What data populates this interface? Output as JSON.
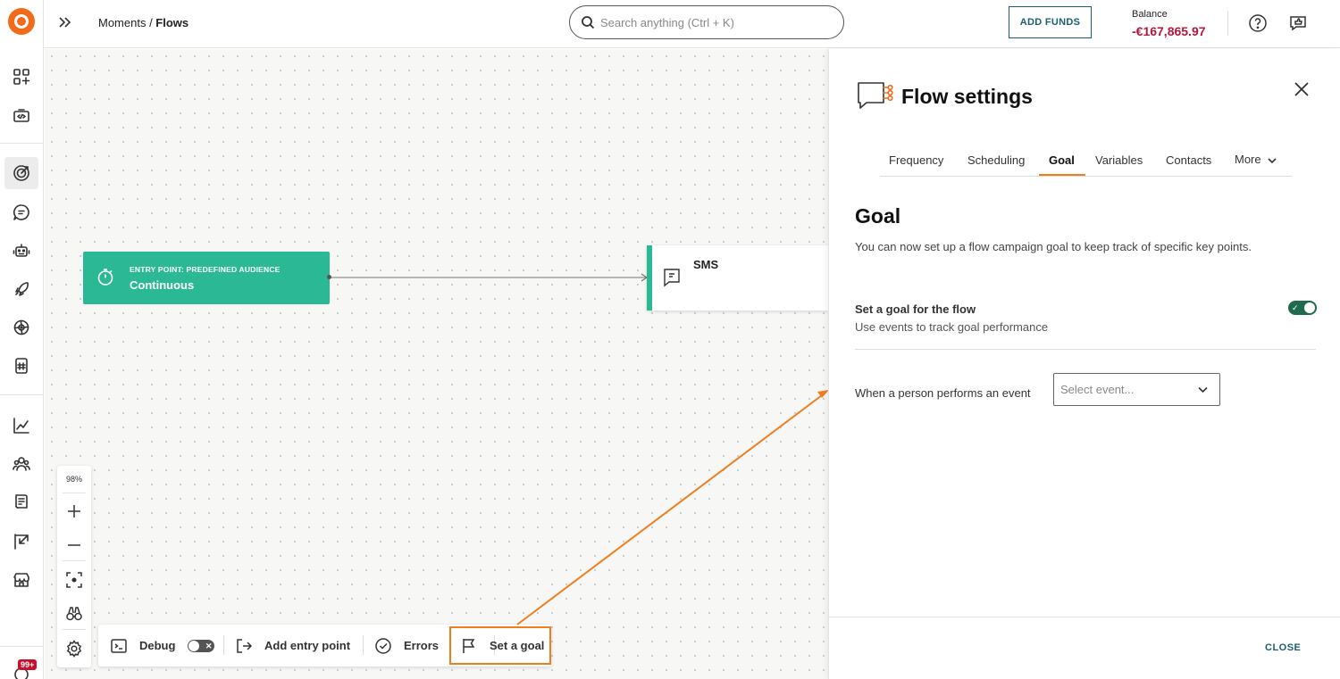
{
  "header": {
    "breadcrumb_parent": "Moments / ",
    "breadcrumb_current": "Flows",
    "search_placeholder": "Search anything (Ctrl + K)",
    "add_funds_label": "ADD FUNDS",
    "balance_label": "Balance",
    "balance_value": "-€167,865.97",
    "icons": [
      "expand-icon",
      "search-icon",
      "help-icon",
      "feedback-icon"
    ]
  },
  "sidebar": {
    "icons": [
      "logo",
      "add-widget-icon",
      "developer-tools-icon",
      "moments-target-icon",
      "conversations-icon",
      "bot-icon",
      "rocket-icon",
      "integrations-icon",
      "hash-icon",
      "analytics-icon",
      "people-icon",
      "documents-icon",
      "exchange-icon",
      "marketplace-icon",
      "notifications-icon"
    ],
    "notification_badge": "99+"
  },
  "canvas": {
    "entry_node": {
      "title": "ENTRY POINT: PREDEFINED AUDIENCE",
      "subtitle": "Continuous",
      "icon": "timer-icon"
    },
    "sms_node": {
      "label": "SMS",
      "icon": "sms-icon"
    },
    "zoom": {
      "level": "98%",
      "buttons": [
        "zoom-in-icon",
        "zoom-out-icon",
        "fit-view-icon",
        "find-icon",
        "settings-icon"
      ]
    },
    "toolbar": {
      "debug_label": "Debug",
      "add_entry_label": "Add entry point",
      "errors_label": "Errors",
      "set_goal_label": "Set a goal"
    }
  },
  "panel": {
    "title": "Flow settings",
    "tabs": [
      "Frequency",
      "Scheduling",
      "Goal",
      "Variables",
      "Contacts",
      "More"
    ],
    "active_tab": "Goal",
    "section_title": "Goal",
    "section_description": "You can now set up a flow campaign goal to keep track of specific key points.",
    "goal_toggle_label": "Set a goal for the flow",
    "goal_toggle_help": "Use events to track goal performance",
    "goal_toggle_on": true,
    "event_label": "When a person performs an event",
    "event_placeholder": "Select event...",
    "close_label": "CLOSE"
  },
  "colors": {
    "brand": "#f26a1b",
    "node_green": "#2bb895",
    "balance_red": "#b5173b",
    "annotation_orange": "#f07e1f",
    "link_teal": "#1b5e70"
  }
}
